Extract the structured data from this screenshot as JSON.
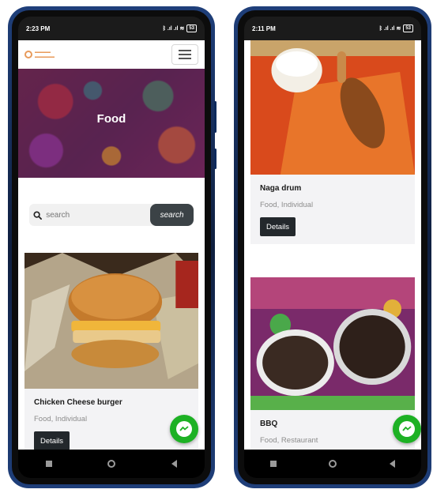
{
  "left_phone": {
    "status_time": "2:23 PM",
    "status_icons": "ᛒ .ıl .ıl ≋",
    "battery": "53",
    "page_title": "Food",
    "search": {
      "placeholder": "search",
      "button_label": "search"
    },
    "cards": [
      {
        "title": "Chicken Cheese burger",
        "subtitle": "Food, Individual",
        "button_label": "Details"
      }
    ]
  },
  "right_phone": {
    "status_time": "2:11 PM",
    "status_icons": "ᛒ .ıl .ıl ≋",
    "battery": "53",
    "cards": [
      {
        "title": "Naga drum",
        "subtitle": "Food, Individual",
        "button_label": "Details"
      },
      {
        "title": "BBQ",
        "subtitle": "Food, Restaurant"
      }
    ]
  },
  "colors": {
    "accent": "#1db124",
    "dark_button": "#23282c",
    "search_button": "#3b4246"
  }
}
